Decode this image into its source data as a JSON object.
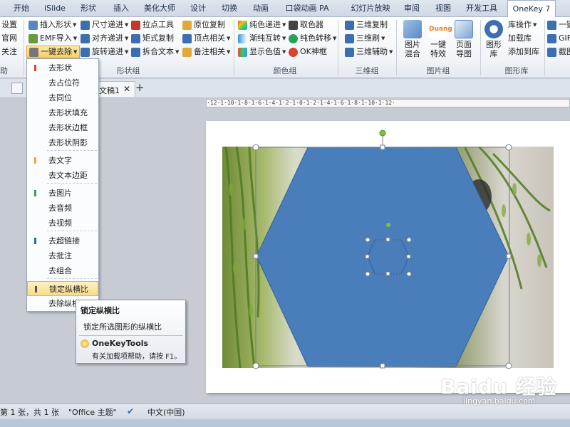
{
  "tabs": [
    "开始",
    "iSlide",
    "形状",
    "插入",
    "美化大师",
    "设计",
    "切换",
    "动画",
    "口袋动画 PA",
    "幻灯片放映",
    "审阅",
    "视图",
    "开发工具",
    "OneKey 7"
  ],
  "ribbon": {
    "left_partial": [
      "设置",
      "官网",
      "关注",
      "助"
    ],
    "shape_group": {
      "col1": [
        "插入形状",
        "EMF导入",
        "一键去除"
      ],
      "col2": [
        "尺寸递进",
        "对齐递进",
        "旋转递进"
      ],
      "col3": [
        "拉点工具",
        "矩式复制",
        "拆合文本"
      ],
      "col4": [
        "原位复制",
        "顶点相关",
        "备注相关"
      ],
      "label": "形状组"
    },
    "color_group": {
      "col1": [
        "纯色递进",
        "渐纯互转",
        "显示色值"
      ],
      "col2": [
        "取色器",
        "纯色转移",
        "OK神框"
      ],
      "label": "颜色组"
    },
    "threed_group": {
      "items": [
        "三维复制",
        "三维刷",
        "三维辅助"
      ],
      "label": "三维组"
    },
    "image_group": {
      "buttons": [
        "图片\n混合",
        "一键\n特效",
        "页面\n导图"
      ],
      "duang": "Duang",
      "label": "图片组"
    },
    "shapelib_group": {
      "button": "图形\n库",
      "items": [
        "库操作",
        "加载库",
        "添加到库"
      ],
      "label": "图形库"
    },
    "right_partial": [
      "一键",
      "GIF",
      "截图"
    ]
  },
  "doc_tab": {
    "name": "文稿1"
  },
  "ruler_text": "·12·1·10·1·8·1·6·1·4·1·2·1·0·1·2·1·4·1·6·1·8·1·10·1·12·",
  "menu": {
    "items": [
      {
        "label": "去形状",
        "color": "#d9442b"
      },
      {
        "label": "去占位符",
        "color": ""
      },
      {
        "label": "去同位",
        "color": ""
      },
      {
        "label": "去形状填充",
        "color": ""
      },
      {
        "label": "去形状边框",
        "color": ""
      },
      {
        "label": "去形状阴影",
        "color": ""
      },
      {
        "label": "去文字",
        "color": "#e8a93a"
      },
      {
        "label": "去文本边距",
        "color": ""
      },
      {
        "label": "去图片",
        "color": "#3f9a5a"
      },
      {
        "label": "去音频",
        "color": ""
      },
      {
        "label": "去视频",
        "color": ""
      },
      {
        "label": "去超链接",
        "color": "#2f67b0"
      },
      {
        "label": "去批注",
        "color": ""
      },
      {
        "label": "去组合",
        "color": ""
      },
      {
        "label": "锁定纵横比",
        "color": "#555555"
      },
      {
        "label": "去除纵横",
        "color": ""
      }
    ]
  },
  "tooltip": {
    "title": "锁定纵横比",
    "desc": "锁定所选图形的纵横比",
    "addin": "OneKeyTools",
    "help": "有关加载项帮助，请按 F1。"
  },
  "status": {
    "slide_count": "第 1 张，共 1 张",
    "theme": "\"Office 主题\"",
    "language": "中文(中国)"
  },
  "colors": {
    "hexagon_fill": "#4a7ebb",
    "hexagon_stroke": "#2f5f99",
    "accent_tab": "#ffffff",
    "handle_green": "#7dc242"
  },
  "watermark": {
    "main": "Baidu 经验",
    "sub": "jingyan.baidu.com"
  }
}
